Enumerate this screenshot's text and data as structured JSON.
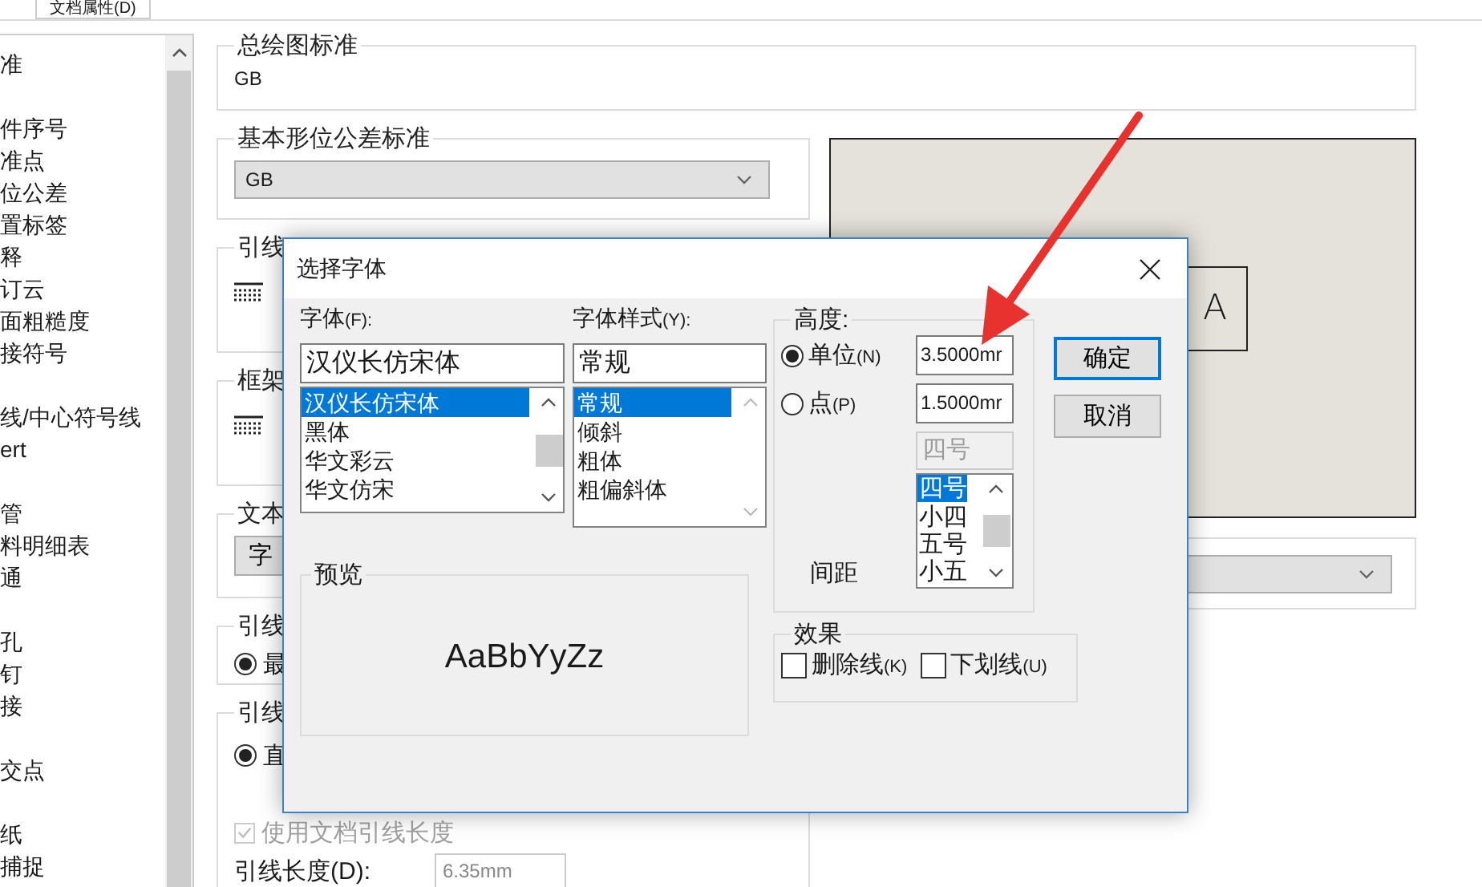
{
  "tabs": [
    {
      "label": "文档属性(D)",
      "selected": true
    }
  ],
  "tree": {
    "groups": [
      [
        "准"
      ],
      [
        "件序号",
        "准点",
        "位公差",
        "置标签",
        "释",
        "订云",
        "面粗糙度",
        "接符号"
      ],
      [
        "线/中心符号线",
        "ert"
      ],
      [
        "管",
        "料明细表",
        "通"
      ],
      [
        "孔",
        "钉",
        "接"
      ],
      [
        "交点"
      ],
      [
        "纸",
        "捕捉"
      ]
    ]
  },
  "general_standard": {
    "title": "总绘图标准",
    "value": "GB"
  },
  "gtol_standard": {
    "title": "基本形位公差标准",
    "value": "GB"
  },
  "sections": [
    {
      "kind": "icon",
      "title": "引线"
    },
    {
      "kind": "icon",
      "title": "框架"
    },
    {
      "kind": "button",
      "title": "文本",
      "button": "字"
    },
    {
      "kind": "radio",
      "title": "引线",
      "option": {
        "label": "最",
        "selected": true
      }
    },
    {
      "kind": "radio_length",
      "title": "引线",
      "option": {
        "label": "直",
        "selected": true
      },
      "checkbox": {
        "label": "使用文档引线长度",
        "checked": true,
        "disabled": true
      },
      "length_label": "引线长度(D):",
      "length_value": "6.35mm"
    }
  ],
  "preview_canvas": {
    "text": "A"
  },
  "dialog": {
    "title": "选择字体",
    "font": {
      "label": "字体",
      "mnemonic": "(F):",
      "value": "汉仪长仿宋体",
      "options": [
        {
          "label": "汉仪长仿宋体",
          "selected": true
        },
        {
          "label": "黑体",
          "selected": false
        },
        {
          "label": "华文彩云",
          "selected": false
        },
        {
          "label": "华文仿宋",
          "selected": false
        }
      ]
    },
    "style": {
      "label": "字体样式",
      "mnemonic": "(Y):",
      "value": "常规",
      "options": [
        {
          "label": "常规",
          "selected": true
        },
        {
          "label": "倾斜",
          "selected": false
        },
        {
          "label": "粗体",
          "selected": false
        },
        {
          "label": "粗偏斜体",
          "selected": false
        }
      ]
    },
    "height": {
      "title": "高度:",
      "modes": [
        {
          "label": "单位",
          "mnemonic": "(N)",
          "selected": true,
          "value": "3.5000mr"
        },
        {
          "label": "点",
          "mnemonic": "(P)",
          "selected": false,
          "value": "1.5000mr"
        }
      ],
      "size_value": "四号",
      "size_disabled": true,
      "size_options": [
        {
          "label": "四号",
          "selected": true
        },
        {
          "label": "小四",
          "selected": false
        },
        {
          "label": "五号",
          "selected": false
        },
        {
          "label": "小五",
          "selected": false
        }
      ],
      "spacing_label": "间距"
    },
    "preview": {
      "title": "预览",
      "sample": "AaBbYyZz"
    },
    "effects": {
      "title": "效果",
      "options": [
        {
          "label": "删除线",
          "mnemonic": "(K)",
          "checked": false
        },
        {
          "label": "下划线",
          "mnemonic": "(U)",
          "checked": false
        }
      ]
    },
    "buttons": [
      {
        "label": "确定",
        "default": true
      },
      {
        "label": "取消",
        "default": false
      }
    ]
  }
}
